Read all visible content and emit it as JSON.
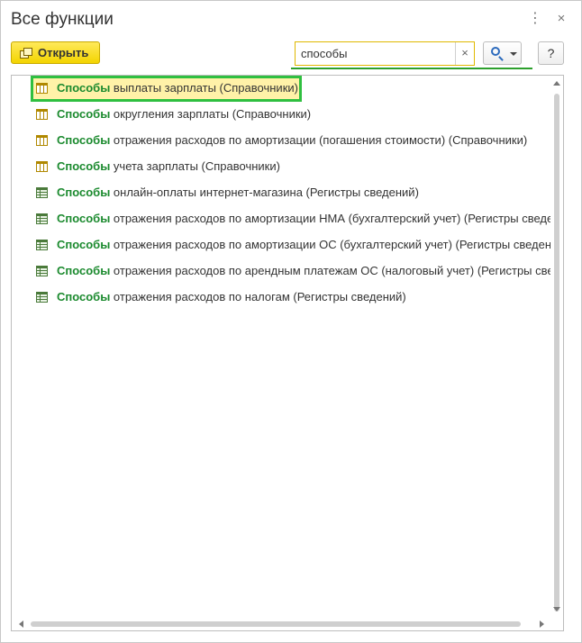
{
  "window": {
    "title": "Все функции",
    "more_icon": "⋮",
    "close_icon": "×"
  },
  "toolbar": {
    "open_label": "Открыть",
    "search_value": "способы",
    "clear_icon": "×",
    "help_label": "?"
  },
  "list": {
    "items": [
      {
        "highlight": "Способы",
        "rest": " выплаты зарплаты (Справочники)",
        "icon": "catalog-icon",
        "selected": true
      },
      {
        "highlight": "Способы",
        "rest": " округления зарплаты (Справочники)",
        "icon": "catalog-icon"
      },
      {
        "highlight": "Способы",
        "rest": " отражения расходов по амортизации (погашения стоимости) (Справочники)",
        "icon": "catalog-icon"
      },
      {
        "highlight": "Способы",
        "rest": " учета зарплаты (Справочники)",
        "icon": "catalog-icon"
      },
      {
        "highlight": "Способы",
        "rest": " онлайн-оплаты интернет-магазина (Регистры сведений)",
        "icon": "register-icon"
      },
      {
        "highlight": "Способы",
        "rest": " отражения расходов по амортизации НМА (бухгалтерский учет) (Регистры сведений)",
        "icon": "register-icon"
      },
      {
        "highlight": "Способы",
        "rest": " отражения расходов по амортизации ОС (бухгалтерский учет) (Регистры сведений)",
        "icon": "register-icon"
      },
      {
        "highlight": "Способы",
        "rest": " отражения расходов по арендным платежам ОС (налоговый учет) (Регистры сведений)",
        "icon": "register-icon"
      },
      {
        "highlight": "Способы",
        "rest": " отражения расходов по налогам (Регистры сведений)",
        "icon": "register-icon"
      }
    ]
  },
  "colors": {
    "highlight_text": "#1b8a2e",
    "selection_border": "#2fbf40",
    "selection_fill": "#fff2a8",
    "open_button": "#f3d400"
  }
}
